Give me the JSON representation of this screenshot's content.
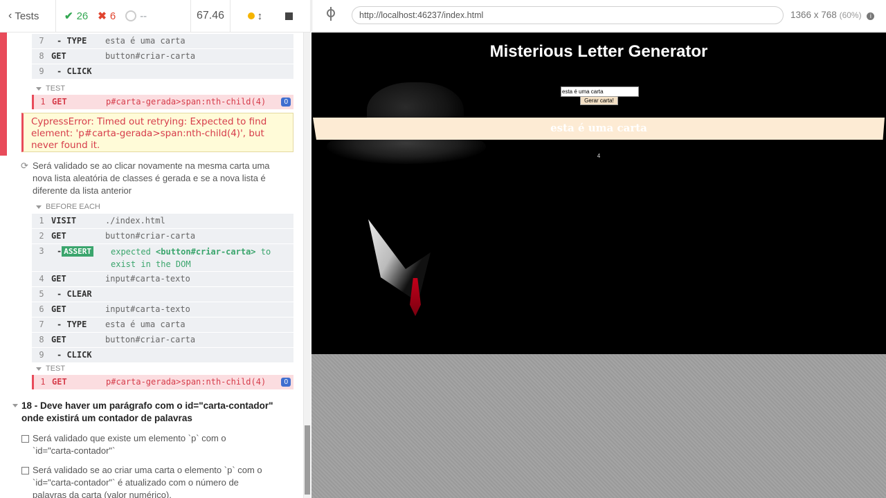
{
  "reporter_header": {
    "tests_label": "Tests",
    "passed_count": "26",
    "failed_count": "6",
    "pending_count": "--",
    "duration": "67.46"
  },
  "block1": {
    "rows": [
      {
        "num": "7",
        "name": "- TYPE",
        "msg": "esta é uma carta"
      },
      {
        "num": "8",
        "name": "GET",
        "msg": "button#criar-carta"
      },
      {
        "num": "9",
        "name": "- CLICK",
        "msg": ""
      }
    ],
    "test_label": "TEST",
    "failed": {
      "num": "1",
      "name": "GET",
      "msg": "p#carta-gerada>span:nth-child(4)",
      "count": "0"
    }
  },
  "error_text": "CypressError: Timed out retrying: Expected to find element: 'p#carta-gerada>span:nth-child(4)', but never found it.",
  "test2_title": "Será validado se ao clicar novamente na mesma carta uma nova lista aleatória de classes é gerada e se a nova lista é diferente da lista anterior",
  "block2": {
    "before_each_label": "BEFORE EACH",
    "rows": [
      {
        "num": "1",
        "name": "VISIT",
        "msg": "./index.html"
      },
      {
        "num": "2",
        "name": "GET",
        "msg": "button#criar-carta"
      },
      {
        "num": "3",
        "name": "ASSERT",
        "msg_pre": "expected ",
        "msg_strong": "<button#criar-carta>",
        "msg_post": " to exist in the DOM"
      },
      {
        "num": "4",
        "name": "GET",
        "msg": "input#carta-texto"
      },
      {
        "num": "5",
        "name": "- CLEAR",
        "msg": ""
      },
      {
        "num": "6",
        "name": "GET",
        "msg": "input#carta-texto"
      },
      {
        "num": "7",
        "name": "- TYPE",
        "msg": "esta é uma carta"
      },
      {
        "num": "8",
        "name": "GET",
        "msg": "button#criar-carta"
      },
      {
        "num": "9",
        "name": "- CLICK",
        "msg": ""
      }
    ],
    "test_label": "TEST",
    "failed": {
      "num": "1",
      "name": "GET",
      "msg": "p#carta-gerada>span:nth-child(4)",
      "count": "0"
    }
  },
  "suite18_title": "18 - Deve haver um parágrafo com o id=\"carta-contador\" onde existirá um contador de palavras",
  "suite18_tests": [
    "Será validado que existe um elemento `p` com o `id=\"carta-contador\"`",
    "Será validado se ao criar uma carta o elemento `p` com o `id=\"carta-contador\"` é atualizado com o número de palavras da carta (valor numérico)."
  ],
  "browser": {
    "url": "http://localhost:46237/index.html",
    "viewport": "1366 x 768",
    "scale": "(60%)"
  },
  "app": {
    "title": "Misterious Letter Generator",
    "input_value": "esta é uma carta",
    "button_label": "Gerar carta!",
    "letter_text": "esta é uma carta",
    "counter": "4"
  },
  "colors": {
    "passed": "#34a853",
    "failed": "#e0442f",
    "fail_bar": "#e84b5a",
    "assert_green": "#3ba56d",
    "letter_bg": "#fdebd4"
  }
}
